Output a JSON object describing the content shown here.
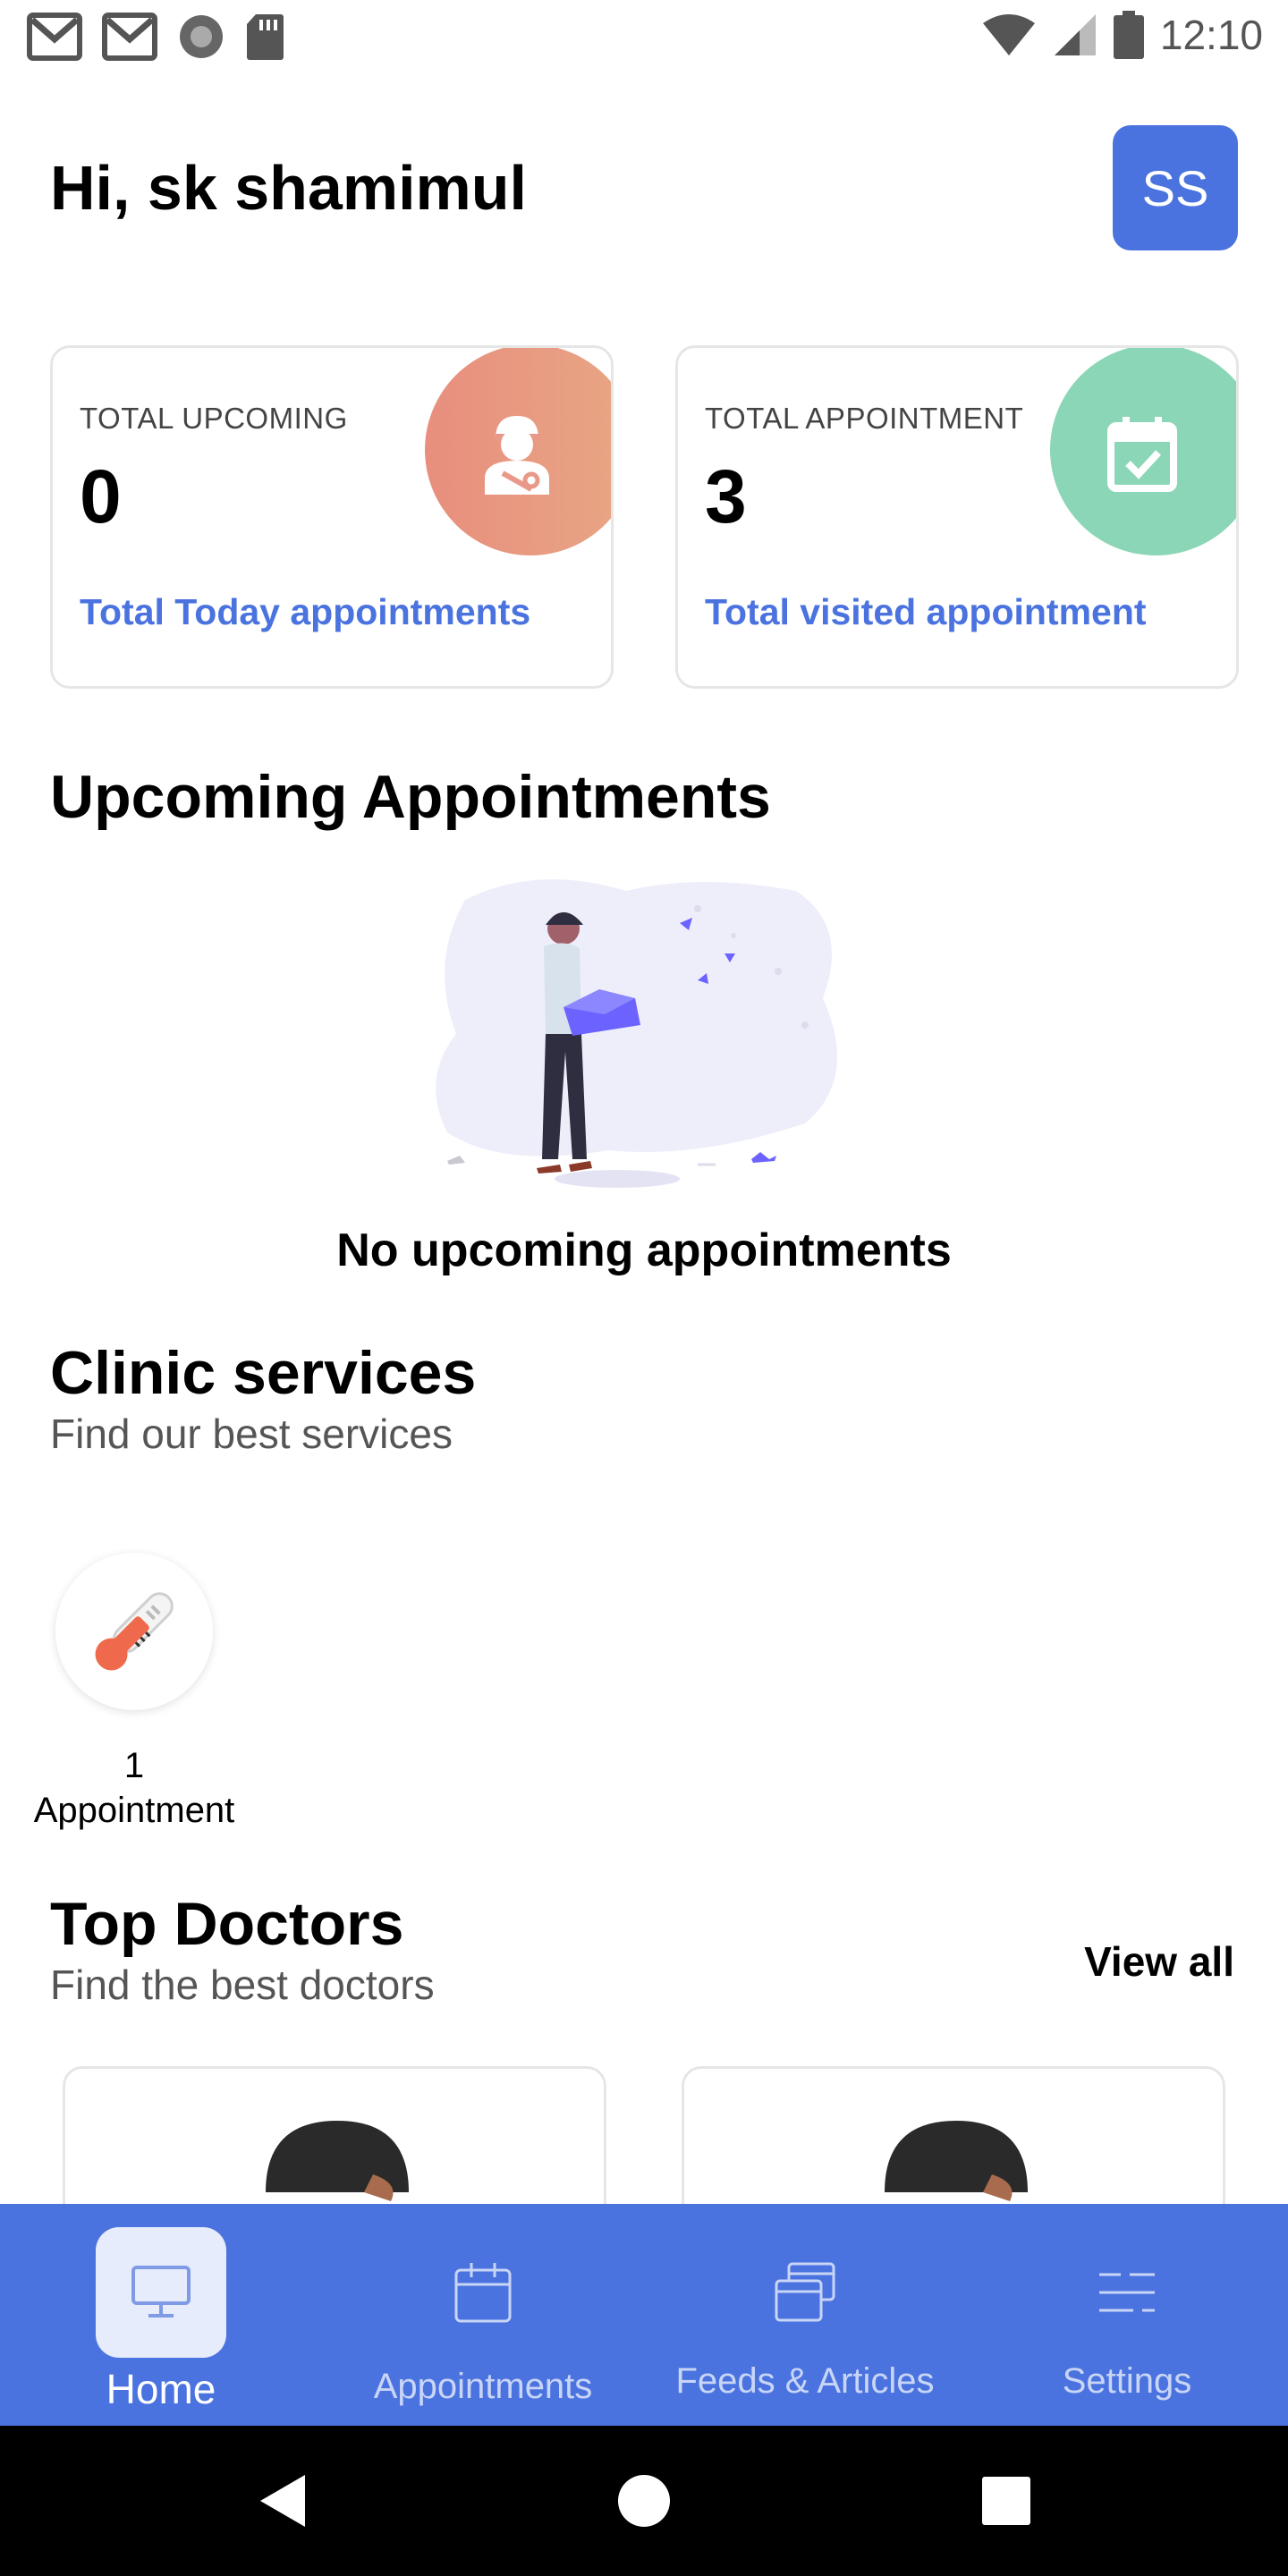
{
  "status_bar": {
    "time": "12:10",
    "left_icons": [
      "gmail-icon",
      "gmail-icon",
      "record-icon",
      "sd-card-icon"
    ],
    "right_icons": [
      "wifi-icon",
      "cell-signal-icon",
      "battery-icon"
    ]
  },
  "header": {
    "greeting": "Hi, sk shamimul",
    "avatar_initials": "SS"
  },
  "stats": [
    {
      "title": "TOTAL UPCOMING",
      "value": "0",
      "link": "Total Today appointments",
      "icon": "patient-icon"
    },
    {
      "title": "TOTAL APPOINTMENT",
      "value": "3",
      "link": "Total visited appointment",
      "icon": "calendar-check-icon"
    }
  ],
  "upcoming": {
    "title": "Upcoming Appointments",
    "empty_text": "No upcoming appointments"
  },
  "clinic": {
    "title": "Clinic services",
    "subtitle": "Find our best services",
    "services": [
      {
        "icon": "thermometer-icon",
        "count": "1",
        "label": "Appointment"
      }
    ]
  },
  "doctors": {
    "title": "Top Doctors",
    "subtitle": "Find the best doctors",
    "view_all": "View all"
  },
  "bottom_nav": {
    "items": [
      {
        "label": "Home",
        "icon": "monitor-icon",
        "active": true
      },
      {
        "label": "Appointments",
        "icon": "calendar-icon",
        "active": false
      },
      {
        "label": "Feeds & Articles",
        "icon": "articles-icon",
        "active": false
      },
      {
        "label": "Settings",
        "icon": "settings-sliders-icon",
        "active": false
      }
    ]
  },
  "colors": {
    "primary": "#4a73df",
    "upcoming_card_accent": "#e8998a",
    "appointment_card_accent": "#8bd6b6",
    "nav_active_bg": "#e6ecfc"
  }
}
